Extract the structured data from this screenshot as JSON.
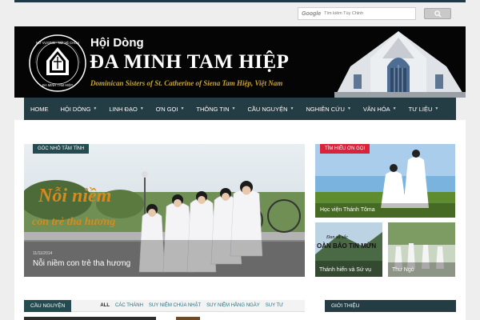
{
  "search": {
    "brand": "Google",
    "placeholder": "Tìm kiếm Tùy Chỉnh"
  },
  "header": {
    "logo_text": "HỘI DÒNG ĐA MINH TAM HIỆP · NỮ VƯƠNG · NỮ VỆ CHÚA",
    "title_small": "Hội Dòng",
    "title_big": "ĐA MINH TAM HIỆP",
    "subtitle": "Dominican Sisters of St. Catherine of Siena Tam Hiệp, Việt Nam"
  },
  "nav": {
    "items": [
      {
        "label": "HOME",
        "caret": false
      },
      {
        "label": "HỘI DÒNG",
        "caret": true
      },
      {
        "label": "LINH ĐẠO",
        "caret": true
      },
      {
        "label": "ƠN GỌI",
        "caret": true
      },
      {
        "label": "THÔNG TIN",
        "caret": true
      },
      {
        "label": "CẦU NGUYỆN",
        "caret": true
      },
      {
        "label": "NGHIÊN CỨU",
        "caret": true
      },
      {
        "label": "VĂN HÓA",
        "caret": true
      },
      {
        "label": "TƯ LIỆU",
        "caret": true
      }
    ]
  },
  "featured": {
    "tag": "GÓC NHỎ TÂM TÌNH",
    "date": "11/11/2014",
    "title": "Nỗi niềm con trẻ tha hương",
    "overlay_line1": "Nỗi niềm",
    "overlay_line2": "con trẻ tha hương"
  },
  "side": {
    "tag": "TÌM HIỂU ƠN GỌI",
    "item1": "Học viện Thánh Tôma",
    "item2": "Thánh hiến và Sứ vụ",
    "item2_overlay1": "Đan xã sắc",
    "item2_overlay2": "OÀN BẢO TIN MỪN",
    "item3": "Thư Ngỏ"
  },
  "sections": {
    "prayer": "CẦU NGUYỆN",
    "tabs": [
      {
        "label": "ALL",
        "active": true
      },
      {
        "label": "CÁC THÁNH",
        "active": false
      },
      {
        "label": "SUY NIỆM CHÚA NHẬT",
        "active": false
      },
      {
        "label": "SUY NIỆM HẰNG NGÀY",
        "active": false
      },
      {
        "label": "SUY TƯ",
        "active": false
      }
    ],
    "intro": "GIỚI THIỆU"
  },
  "colors": {
    "nav": "#243c44",
    "tag_teal": "#244b4f",
    "tag_red": "#d8233a",
    "gold": "#c9a53a"
  }
}
